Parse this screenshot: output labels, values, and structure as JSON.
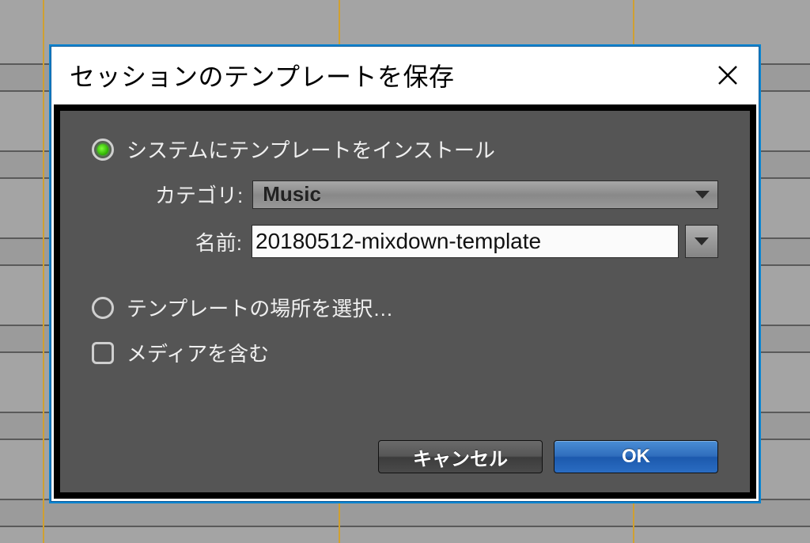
{
  "dialog": {
    "title": "セッションのテンプレートを保存",
    "options": {
      "install_to_system": {
        "label": "システムにテンプレートをインストール",
        "selected": true
      },
      "choose_location": {
        "label": "テンプレートの場所を選択…",
        "selected": false
      },
      "include_media": {
        "label": "メディアを含む",
        "checked": false
      }
    },
    "fields": {
      "category": {
        "label": "カテゴリ:",
        "value": "Music"
      },
      "name": {
        "label": "名前:",
        "value": "20180512-mixdown-template"
      }
    },
    "buttons": {
      "cancel": "キャンセル",
      "ok": "OK"
    }
  }
}
